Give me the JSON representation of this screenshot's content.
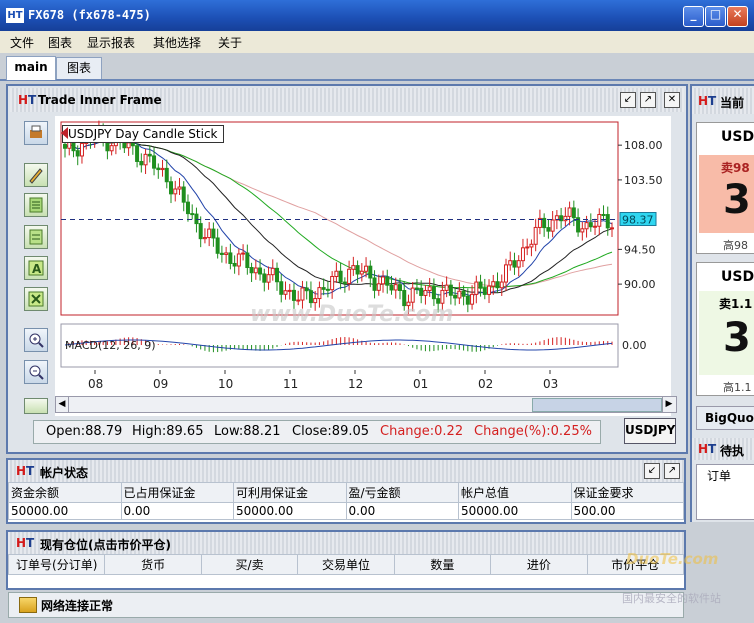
{
  "window": {
    "title": "FX678  (fx678-475)",
    "logo": "HT"
  },
  "menu": [
    "文件",
    "图表",
    "显示报表",
    "其他选择",
    "关于"
  ],
  "tabs": [
    "main",
    "图表"
  ],
  "chart_frame": {
    "title": "Trade Inner Frame",
    "legend": "USDJPY  Day  Candle Stick",
    "current_price_label": "98.37",
    "macd_label": "MACD(12, 26, 9)",
    "info": {
      "open": "Open:88.79",
      "high": "High:89.65",
      "low": "Low:88.21",
      "close": "Close:89.05",
      "change": "Change:0.22",
      "change_pct": "Change(%):0.25%"
    },
    "symbol_button": "USDJPY"
  },
  "chart_data": {
    "type": "line",
    "title": "USDJPY  Day  Candle Stick",
    "x": [
      "08",
      "09",
      "10",
      "11",
      "12",
      "01",
      "02",
      "03"
    ],
    "ylim": [
      86.0,
      111.0
    ],
    "yticks": [
      108.0,
      103.5,
      94.5,
      90.0
    ],
    "ytick_labels": [
      "108.00",
      "103.50",
      "94.50",
      "90.00"
    ],
    "current_price": 98.37,
    "series": [
      {
        "values": [
          107.0,
          109.0,
          108.5,
          106.5,
          103.5,
          98.0,
          94.0,
          92.5,
          90.5,
          88.0,
          89.5,
          92.0,
          90.5,
          88.5,
          89.0,
          88.5,
          89.0,
          91.5,
          96.5,
          99.0,
          97.5,
          98.4
        ]
      }
    ],
    "macd": {
      "label": "MACD(12, 26, 9)",
      "ytick": "0.00"
    },
    "grid": false,
    "colors": {
      "candle_up": "#d42020",
      "candle_down": "#1f8f1f",
      "ma_red": "#e06060",
      "ma_green": "#22aa22",
      "ma_black": "#222222",
      "ma_blue": "#2244aa",
      "ma_pink": "#e0a0a0"
    }
  },
  "account": {
    "title": "帐户状态",
    "headers": [
      "资金余额",
      "已占用保证金",
      "可利用保证金",
      "盈/亏金额",
      "帐户总值",
      "保证金要求"
    ],
    "values": [
      "50000.00",
      "0.00",
      "50000.00",
      "0.00",
      "50000.00",
      "500.00"
    ]
  },
  "positions": {
    "title": "现有仓位(点击市价平仓)",
    "headers": [
      "订单号(分订单)",
      "货币",
      "买/卖",
      "交易单位",
      "数量",
      "进价",
      "市价平仓"
    ]
  },
  "status": {
    "text": "网络连接正常"
  },
  "right_panel": {
    "title": "当前",
    "quote1": {
      "symbol": "USD",
      "sell": "卖98",
      "big": "3",
      "high": "高98"
    },
    "quote2": {
      "symbol": "USD",
      "sell": "卖1.1",
      "big": "3",
      "high": "高1.1"
    },
    "bigquote": "BigQuot",
    "pending_title": "待执",
    "pending_header": "订单"
  },
  "watermark": {
    "main": "www.DuoTe.com",
    "corner1": "DuoTe.com",
    "corner2": "国内最安全的软件站"
  }
}
